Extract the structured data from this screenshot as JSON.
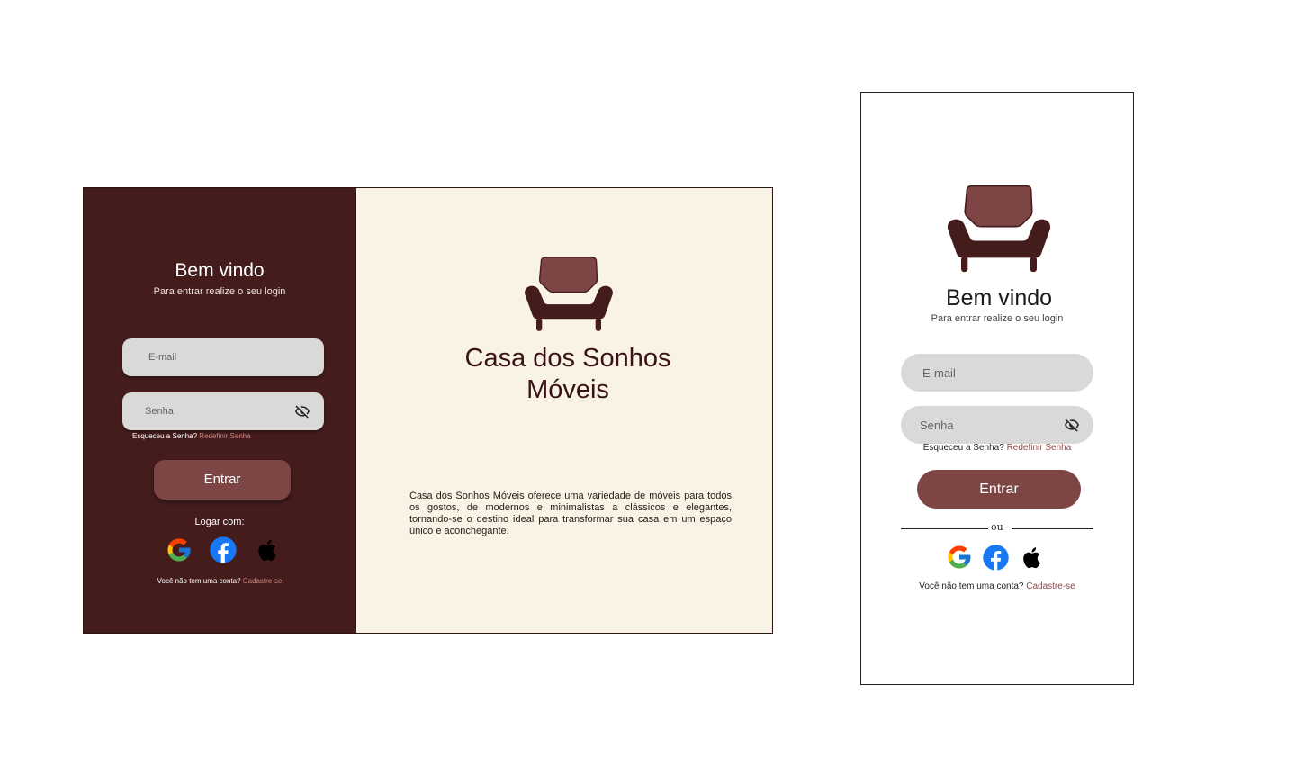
{
  "desktop": {
    "welcome_title": "Bem vindo",
    "welcome_subtitle": "Para entrar realize o seu login",
    "email_placeholder": "E-mail",
    "password_placeholder": "Senha",
    "forgot_text": "Esqueceu a Senha?",
    "forgot_link": "Redefinir Senha",
    "login_button": "Entrar",
    "login_with": "Logar com:",
    "no_account_text": "Você não tem uma conta?",
    "signup_link": "Cadastre-se",
    "brand_line1": "Casa dos Sonhos",
    "brand_line2": "Móveis",
    "description": "Casa dos Sonhos Móveis oferece uma variedade de móveis para todos os gostos, de modernos e minimalistas a clássicos e elegantes, tornando-se o destino ideal para transformar sua casa em um espaço único e aconchegante."
  },
  "mobile": {
    "welcome_title": "Bem vindo",
    "welcome_subtitle": "Para entrar realize o seu login",
    "email_placeholder": "E-mail",
    "password_placeholder": "Senha",
    "forgot_text": "Esqueceu a Senha?",
    "forgot_link": "Redefinir Senha",
    "login_button": "Entrar",
    "or_divider": "ou",
    "no_account_text": "Você não tem uma conta?",
    "signup_link": "Cadastre-se"
  },
  "icons": {
    "logo": "armchair-icon",
    "password_toggle": "eye-off-icon",
    "social": [
      "google-icon",
      "facebook-icon",
      "apple-icon"
    ]
  },
  "colors": {
    "sidebar_bg": "#441c1c",
    "panel_bg": "#f8f3e4",
    "button": "#7e4545",
    "link_desktop": "#d2857f",
    "link_mobile": "#8a4a4a",
    "input_bg": "#d9d9d9"
  }
}
